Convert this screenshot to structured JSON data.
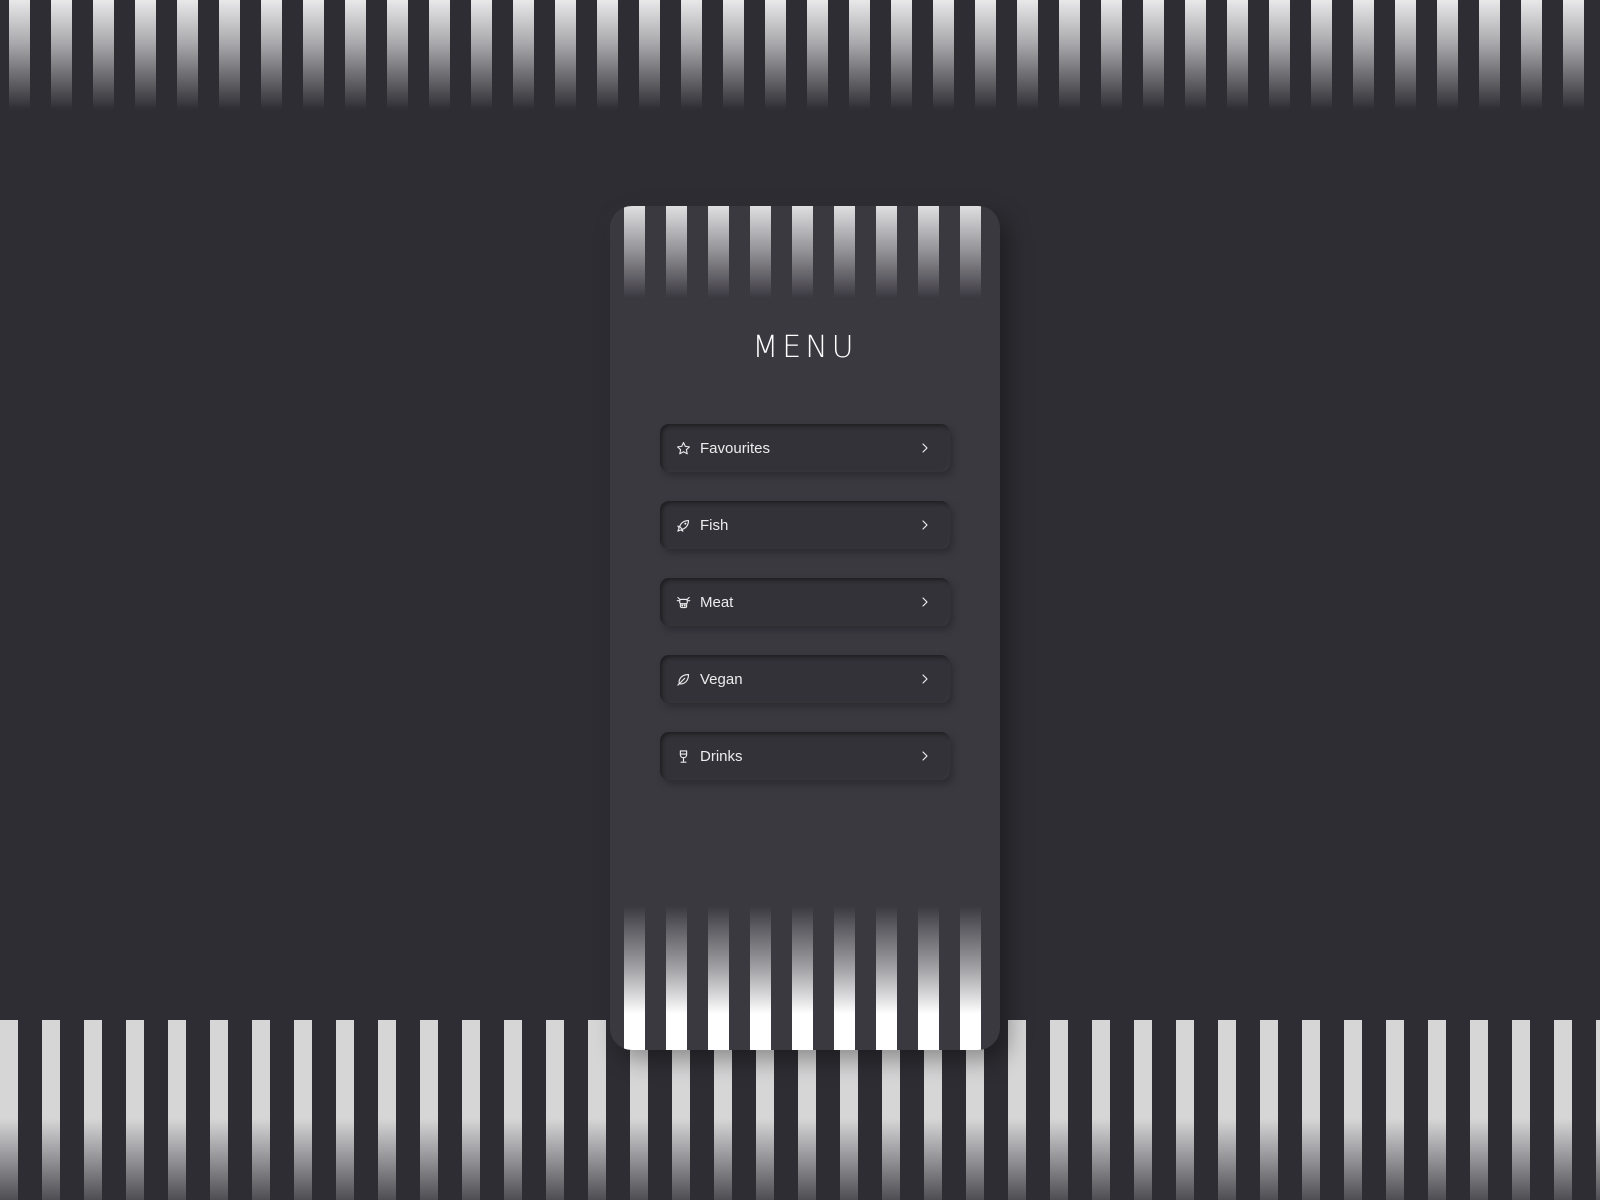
{
  "app": {
    "title": "MENU"
  },
  "menu": {
    "items": [
      {
        "label": "Favourites",
        "icon": "star-icon"
      },
      {
        "label": "Fish",
        "icon": "fish-icon"
      },
      {
        "label": "Meat",
        "icon": "cow-icon"
      },
      {
        "label": "Vegan",
        "icon": "leaf-icon"
      },
      {
        "label": "Drinks",
        "icon": "wine-glass-icon"
      }
    ],
    "chevron_icon": "chevron-right-icon"
  },
  "colors": {
    "background": "#2e2d33",
    "card": "#3a3940",
    "button": "#333238",
    "text": "#ececee",
    "stripe": "#e8e8e9"
  }
}
